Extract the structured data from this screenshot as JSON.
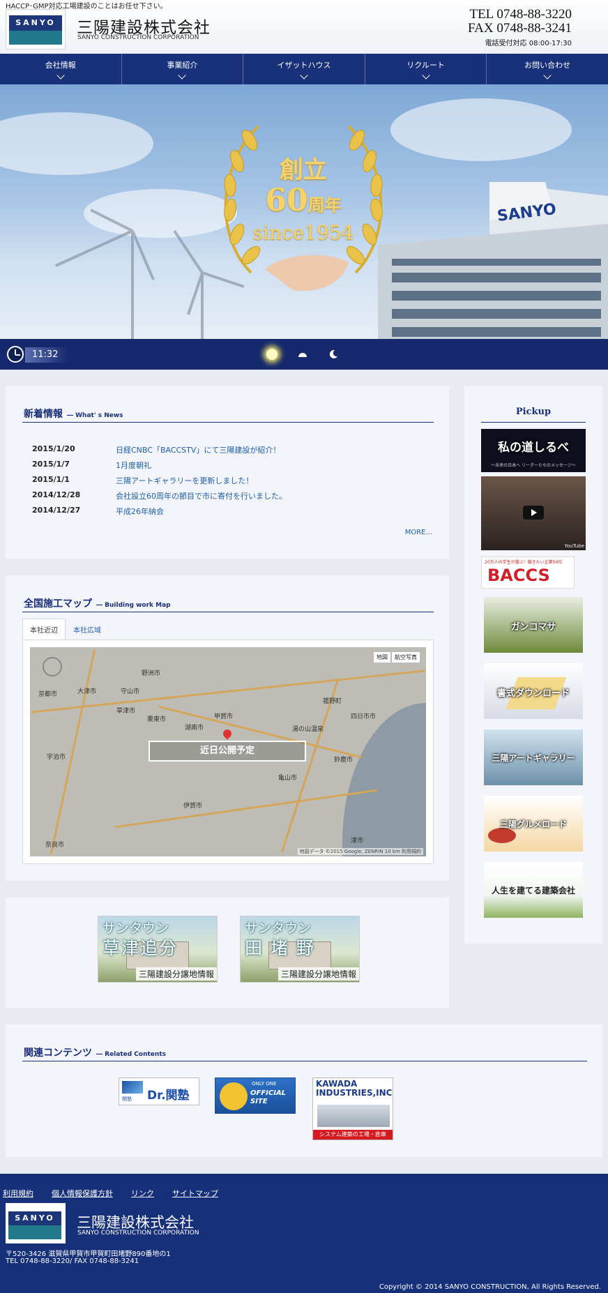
{
  "header": {
    "tagline": "HACCP･GMP対応工場建設のことはお任せ下さい。",
    "logo_text": "SANYO",
    "company_name": "三陽建設株式会社",
    "company_en": "SANYO CONSTRUCTION CORPORATION",
    "tel": "TEL 0748-88-3220",
    "fax": "FAX 0748-88-3241",
    "hours": "電話受付対応 08:00-17:30"
  },
  "nav": {
    "items": [
      "会社情報",
      "事業紹介",
      "イザットハウス",
      "リクルート",
      "お問い合わせ"
    ]
  },
  "hero": {
    "line1": "創立",
    "line2_num": "60",
    "line2_unit": "周年",
    "line3": "since1954",
    "building_sign": "SANYO"
  },
  "timebar": {
    "time": "11:32"
  },
  "news": {
    "title": "新着情報",
    "subtitle": "― What' s News",
    "items": [
      {
        "date": "2015/1/20",
        "text": "日経CNBC「BACCSTV」にて三陽建設が紹介！"
      },
      {
        "date": "2015/1/7",
        "text": "1月度朝礼"
      },
      {
        "date": "2015/1/1",
        "text": "三陽アートギャラリーを更新しました！"
      },
      {
        "date": "2014/12/28",
        "text": "会社設立60周年の節目で市に寄付を行いました。"
      },
      {
        "date": "2014/12/27",
        "text": "平成26年納会"
      }
    ],
    "more": "MORE..."
  },
  "map": {
    "title": "全国施工マップ",
    "subtitle": "― Building work Map",
    "tabs": [
      "本社近辺",
      "本社広域"
    ],
    "overlay_label": "近日公開予定",
    "type_buttons": [
      "地図",
      "航空写真"
    ],
    "credit": "地図データ ©2015 Google, ZENRIN   10 km   利用規約",
    "cities": [
      "野洲市",
      "守山市",
      "京都市",
      "大津市",
      "草津市",
      "栗東市",
      "湖南市",
      "甲賀市",
      "湯の山温泉",
      "四日市市",
      "亀山市",
      "宇治市",
      "伊賀市",
      "津市",
      "奈良市",
      "菰野町",
      "鈴鹿市"
    ]
  },
  "subdivisions": [
    {
      "line1": "サンタウン",
      "line2": "草津追分",
      "caption": "三陽建設分譲地情報"
    },
    {
      "line1": "サンタウン",
      "line2": "田 堵 野",
      "caption": "三陽建設分譲地情報"
    }
  ],
  "pickup": {
    "title": "Pickup",
    "items": [
      {
        "text": "私の道しるべ",
        "sub": "～未来の日本へ リーダーたちのメッセージ～"
      },
      {
        "text": "",
        "sub": "YouTube"
      },
      {
        "text": "BACCS",
        "sub": "20万人の学生が選ぶ！働きたい企業50社"
      },
      {
        "text": "ガンコマサ",
        "sub": ""
      },
      {
        "text": "書式ダウンロード",
        "sub": ""
      },
      {
        "text": "三陽アートギャラリー",
        "sub": ""
      },
      {
        "text": "三陽グルメロード",
        "sub": ""
      },
      {
        "text": "人生を建てる建築会社",
        "sub": ""
      }
    ]
  },
  "related": {
    "title": "関連コンテンツ",
    "subtitle": "― Related Contents",
    "items": [
      {
        "label": "Dr.関塾",
        "small": "関塾"
      },
      {
        "label": "OFFICIAL SITE",
        "small": "ONLY ONE"
      },
      {
        "label": "KAWADA INDUSTRIES,INC.",
        "small": "システム建築の工場・倉庫"
      }
    ]
  },
  "footer": {
    "links": [
      "利用規約",
      "個人情報保護方針",
      "リンク",
      "サイトマップ"
    ],
    "logo_text": "SANYO",
    "company_name": "三陽建設株式会社",
    "company_en": "SANYO CONSTRUCTION CORPORATION",
    "address": "〒520-3426 滋賀県甲賀市甲賀町田堵野890番地の1",
    "tel": "TEL 0748-88-3220/ FAX 0748-88-3241",
    "copyright": "Copyright © 2014 SANYO CONSTRUCTION, All Rights Reserved."
  },
  "colors": {
    "navy": "#19307a",
    "link": "#1d5fa8",
    "panel_bg": "#f4f5fa",
    "gold": "#f6d36a"
  }
}
